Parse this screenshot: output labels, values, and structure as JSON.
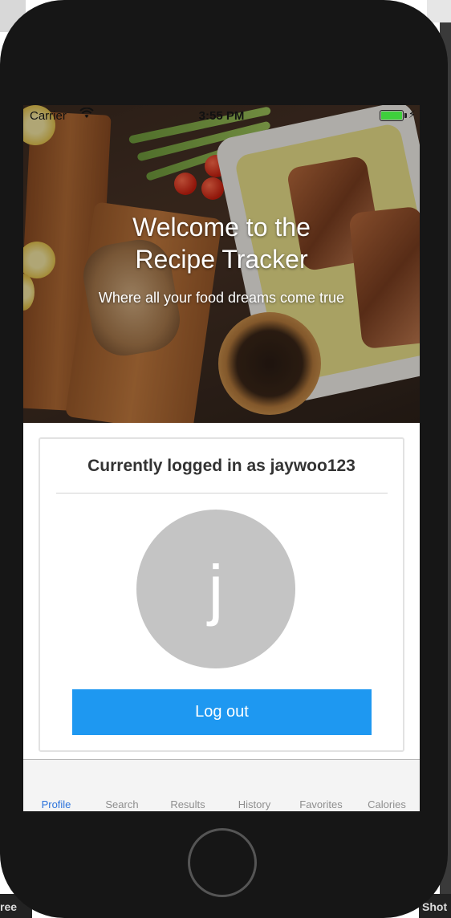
{
  "status_bar": {
    "carrier": "Carrier",
    "time": "3:55 PM",
    "wifi_icon": "wifi-icon",
    "battery_level": 1.0,
    "charging_icon": "bolt-icon"
  },
  "hero": {
    "title": "Welcome to the\nRecipe Tracker",
    "subtitle": "Where all your food dreams come true"
  },
  "profile": {
    "logged_in_text": "Currently logged in as jaywoo123",
    "avatar_letter": "j",
    "logout_label": "Log out"
  },
  "tabs": [
    {
      "label": "Profile",
      "active": true
    },
    {
      "label": "Search",
      "active": false
    },
    {
      "label": "Results",
      "active": false
    },
    {
      "label": "History",
      "active": false
    },
    {
      "label": "Favorites",
      "active": false
    },
    {
      "label": "Calories",
      "active": false
    }
  ],
  "desktop": {
    "left_text": "ree",
    "right_text": "Shot"
  },
  "colors": {
    "accent": "#1e98f1",
    "tab_active": "#2c73db",
    "avatar_bg": "#c4c4c4",
    "battery": "#3fcf3c"
  }
}
